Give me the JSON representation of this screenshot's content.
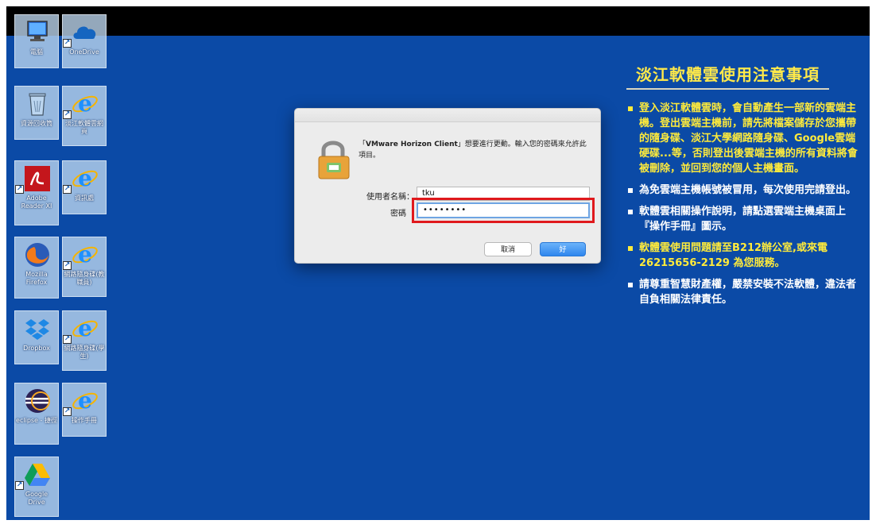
{
  "desktop": {
    "icons": [
      {
        "label": "電腦",
        "icon": "computer-icon"
      },
      {
        "label": "OneDrive",
        "icon": "onedrive-cloud-icon"
      },
      {
        "label": "資源回收筒",
        "icon": "recycle-bin-icon"
      },
      {
        "label": "淡江軟體雲網頁",
        "icon": "internet-explorer-icon"
      },
      {
        "label": "Adobe Reader XI",
        "icon": "adobe-reader-icon"
      },
      {
        "label": "資訊處",
        "icon": "internet-explorer-icon"
      },
      {
        "label": "Mozilla Firefox",
        "icon": "firefox-icon"
      },
      {
        "label": "網路隨身碟(教職員)",
        "icon": "internet-explorer-icon"
      },
      {
        "label": "Dropbox",
        "icon": "dropbox-icon"
      },
      {
        "label": "網路隨身碟(學生)",
        "icon": "internet-explorer-icon"
      },
      {
        "label": "eclipse - 捷徑",
        "icon": "eclipse-icon"
      },
      {
        "label": "操作手冊",
        "icon": "internet-explorer-icon"
      },
      {
        "label": "Google Drive",
        "icon": "google-drive-icon"
      }
    ]
  },
  "notice": {
    "title": "淡江軟體雲使用注意事項",
    "items": [
      {
        "text": "登入淡江軟體雲時，會自動產生一部新的雲端主機。登出雲端主機前，請先將檔案儲存於您攜帶的隨身碟、淡江大學網路隨身碟、Google雲端硬碟...等，否則登出後雲端主機的所有資料將會被刪除，並回到您的個人主機畫面。",
        "color": "#ffeb3b"
      },
      {
        "text": "為免雲端主機帳號被冒用，每次使用完請登出。",
        "color": "#ffffff"
      },
      {
        "text": "軟體雲相關操作說明，請點選雲端主機桌面上『操作手冊』圖示。",
        "color": "#ffffff"
      },
      {
        "text": "軟體雲使用問題請至B212辦公室,或來電26215656-2129 為您服務。",
        "color": "#ffeb3b"
      },
      {
        "text": "請尊重智慧財產權，嚴禁安裝不法軟體，違法者自負相關法律責任。",
        "color": "#ffffff"
      }
    ]
  },
  "dialog": {
    "message": "「VMware Horizon Client」想要進行更動。輸入您的密碼來允許此項目。",
    "app_name": "VMware Horizon Client",
    "username_label": "使用者名稱：",
    "username_value": "tku",
    "password_label": "密碼",
    "password_value": "••••••••",
    "cancel_label": "取消",
    "ok_label": "好"
  },
  "colors": {
    "desktop_background": "#0b4aa6",
    "notice_accent": "#ffeb3b",
    "highlight": "#e0191d",
    "ok_button": "#2e86ee"
  }
}
